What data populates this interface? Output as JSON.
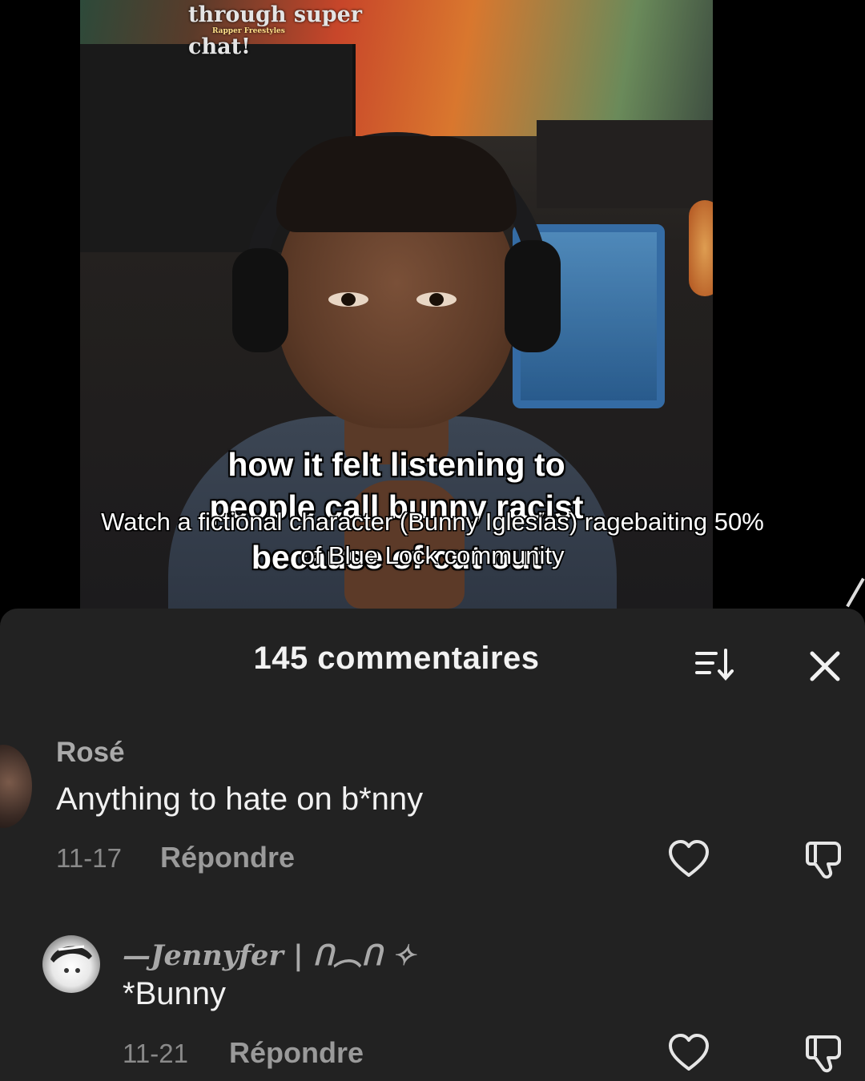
{
  "video": {
    "chat_overlay": {
      "line1": "through super",
      "line2": "chat!",
      "small": "Rapper Freestyles"
    },
    "caption": {
      "line1": "how it felt listening to",
      "line2": "people call bunny racist",
      "line3": "because of cut out"
    },
    "description": {
      "line1": "Watch a fictional character (Bunny Iglesias) ragebaiting 50%",
      "line2": "of Blue Lock community"
    }
  },
  "comments_panel": {
    "title": "145 commentaires",
    "sort_icon": "sort-descending-icon",
    "close_icon": "close-icon",
    "comments": [
      {
        "username": "Rosé",
        "text": "Anything to hate on b*nny",
        "date": "11-17",
        "reply_label": "Répondre"
      },
      {
        "username": "—Jennyfer | ᑎ︵ᑎ ✧",
        "text": "*Bunny",
        "date": "11-21",
        "reply_label": "Répondre"
      }
    ]
  },
  "colors": {
    "sheet_background": "#222222",
    "primary_text": "#f1f1f1",
    "secondary_text": "#8a8a8a"
  }
}
